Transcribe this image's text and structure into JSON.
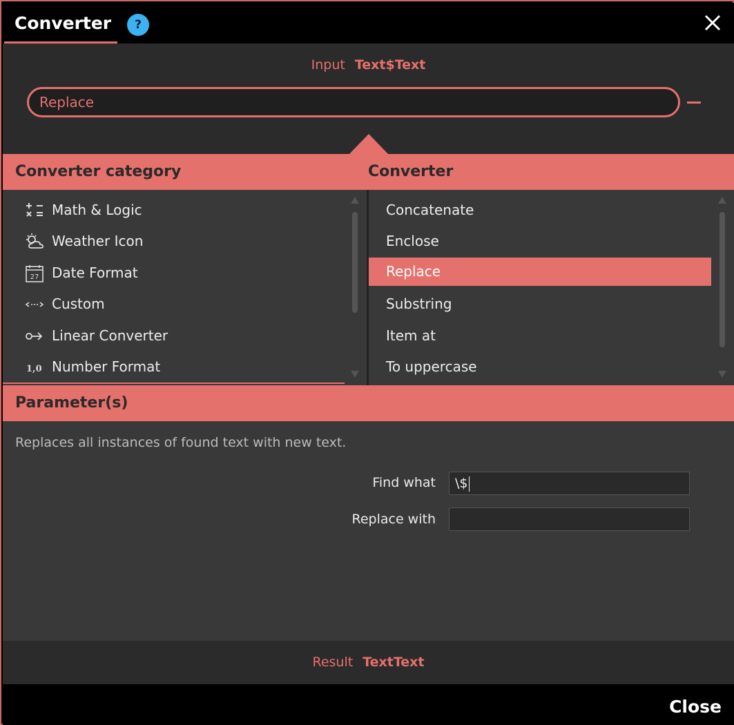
{
  "window": {
    "title": "Converter",
    "help_label": "?"
  },
  "input": {
    "label": "Input",
    "value": "Text$Text"
  },
  "selected_converter": {
    "label": "Replace"
  },
  "categories": {
    "header": "Converter category",
    "items": [
      {
        "label": "Math & Logic",
        "icon": "math-icon"
      },
      {
        "label": "Weather Icon",
        "icon": "weather-icon"
      },
      {
        "label": "Date Format",
        "icon": "calendar-icon"
      },
      {
        "label": "Custom",
        "icon": "custom-icon"
      },
      {
        "label": "Linear Converter",
        "icon": "linear-icon"
      },
      {
        "label": "Number Format",
        "icon": "number-format-icon"
      }
    ]
  },
  "converters": {
    "header": "Converter",
    "items": [
      {
        "label": "Concatenate"
      },
      {
        "label": "Enclose"
      },
      {
        "label": "Replace"
      },
      {
        "label": "Substring"
      },
      {
        "label": "Item at"
      },
      {
        "label": "To uppercase"
      }
    ],
    "selected_index": 2
  },
  "parameters": {
    "header": "Parameter(s)",
    "description": "Replaces all instances of found text with new text.",
    "fields": [
      {
        "label": "Find what",
        "value": "\\$"
      },
      {
        "label": "Replace with",
        "value": ""
      }
    ]
  },
  "result": {
    "label": "Result",
    "value": "TextText"
  },
  "footer": {
    "close_label": "Close"
  },
  "colors": {
    "accent": "#e5716c",
    "help": "#3cb2f2"
  }
}
